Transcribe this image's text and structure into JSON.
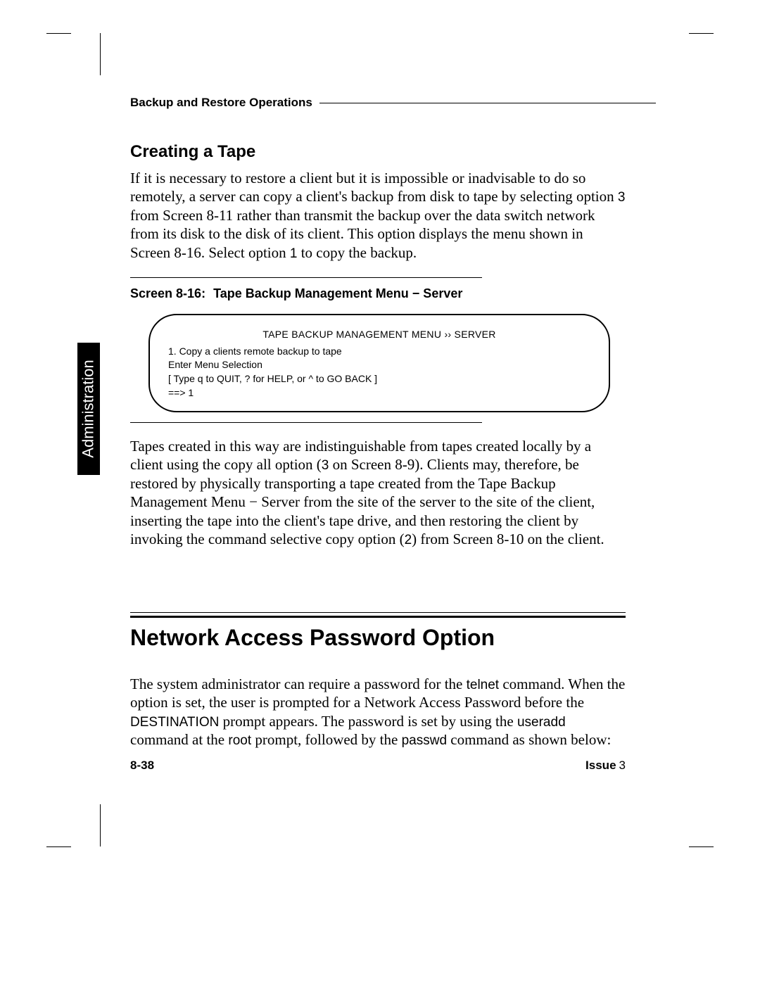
{
  "running_header": "Backup and Restore Operations",
  "side_tab": "Administration",
  "section1": {
    "heading": "Creating a Tape",
    "para1_a": "If it is necessary to restore a client but it is impossible or inadvisable to do so remotely, a server can copy a client's backup from disk to tape by selecting option ",
    "opt3": "3",
    "para1_b": " from Screen 8-11 rather than transmit the backup over the data switch network from its disk to the disk of its client.  This option displays the menu shown in Screen 8-16. Select option ",
    "opt1": "1",
    "para1_c": " to copy the backup.",
    "screen_caption_num": "Screen 8-16:",
    "screen_caption_text": "Tape Backup Management Menu −  Server",
    "terminal": {
      "title": "TAPE BACKUP MANAGEMENT MENU ›› SERVER",
      "line1": "1. Copy a clients remote backup to tape",
      "line2": "Enter Menu Selection",
      "line3": "[ Type q to QUIT, ? for HELP, or ^ to GO BACK ]",
      "line4": "==>  1"
    },
    "para2_a": "Tapes created in this way are indistinguishable from tapes created locally by a client using the copy all option (",
    "p2_opt3": "3",
    "para2_b": " on Screen 8-9).  Clients may, therefore, be restored by physically transporting a tape created from the Tape Backup Management Menu − Server from the site of the server to the site of the client, inserting the tape into the client's tape drive, and then restoring the client by invoking the command selective copy option (",
    "p2_opt2": "2",
    "para2_c": ") from Screen 8-10 on the client."
  },
  "section2": {
    "heading": "Network Access Password Option",
    "para_a": "The system administrator can require a password for the ",
    "cmd_telnet": "telnet",
    "para_b": "  command.  When the option is set, the user is prompted for a Network Access Password before the ",
    "cmd_dest": "DESTINATION",
    "para_c": " prompt appears. The password is set by using the ",
    "cmd_useradd": "useradd",
    "para_d": " command at the ",
    "cmd_root": "root",
    "para_e": "  prompt, followed by the ",
    "cmd_passwd": "passwd",
    "para_f": " command as shown below:"
  },
  "footer": {
    "page": "8-38",
    "issue_label": "Issue",
    "issue_num": "3"
  }
}
